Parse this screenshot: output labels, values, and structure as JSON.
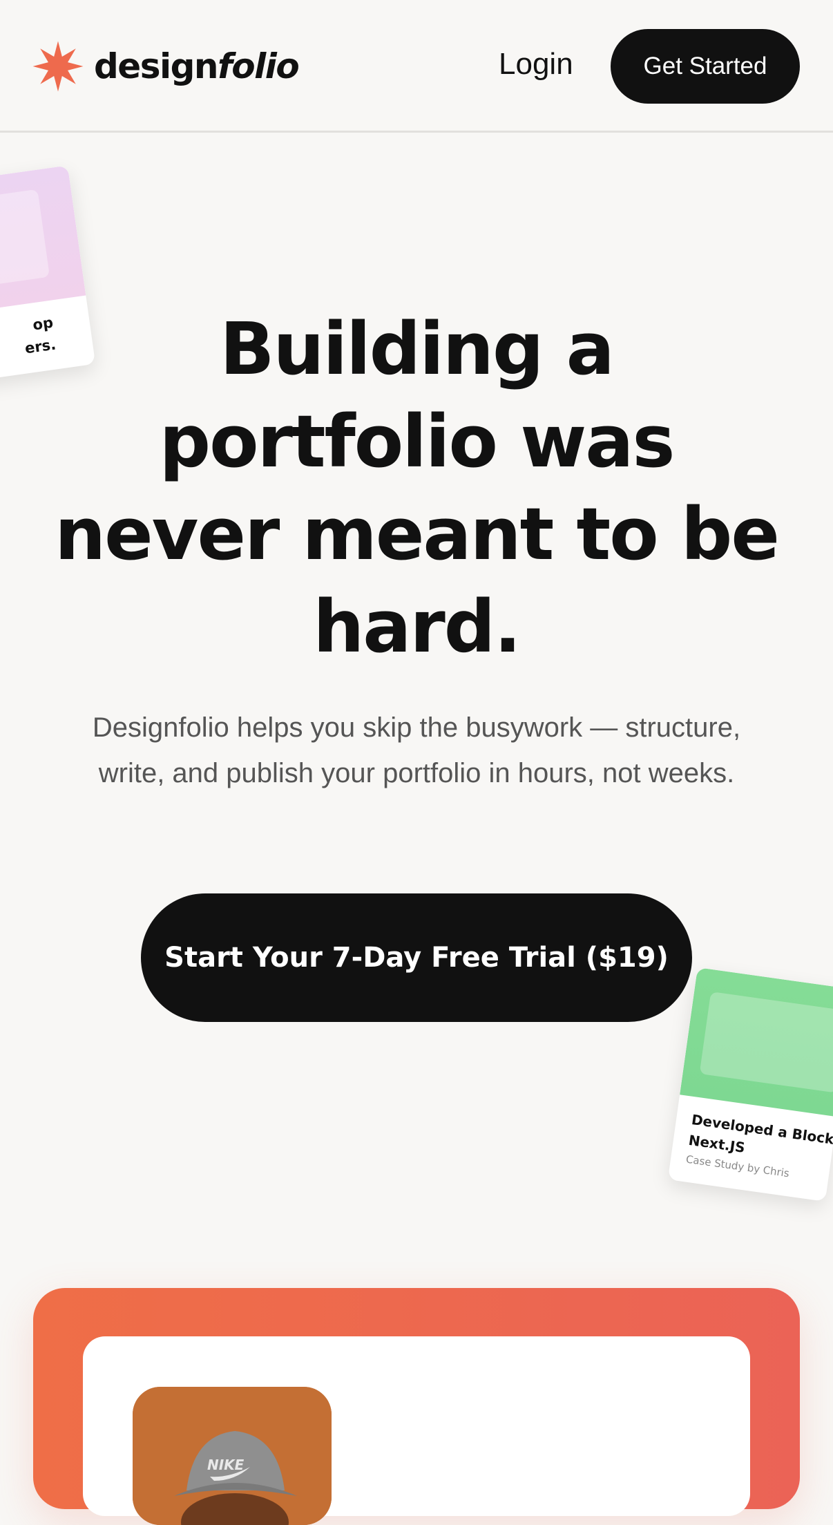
{
  "header": {
    "logo_text_regular": "design",
    "logo_text_italic": "folio",
    "login_label": "Login",
    "get_started_label": "Get Started"
  },
  "colors": {
    "accent": "#ee6a4d",
    "background": "#f8f7f5",
    "dark": "#111111"
  },
  "floating_cards": {
    "left": {
      "title": "...op\n...ers."
    },
    "right": {
      "title": "Developed a Blockch",
      "title_line2": "Next.JS",
      "subtitle": "Case Study by Chris"
    }
  },
  "hero": {
    "title": "Building a portfolio was never meant to be hard.",
    "subtitle": "Designfolio helps you skip the busywork — structure, write, and publish your portfolio in hours, not weeks.",
    "cta_label": "Start Your 7-Day Free Trial ($19)"
  },
  "avatar": {
    "hat_text": "NIKE"
  }
}
